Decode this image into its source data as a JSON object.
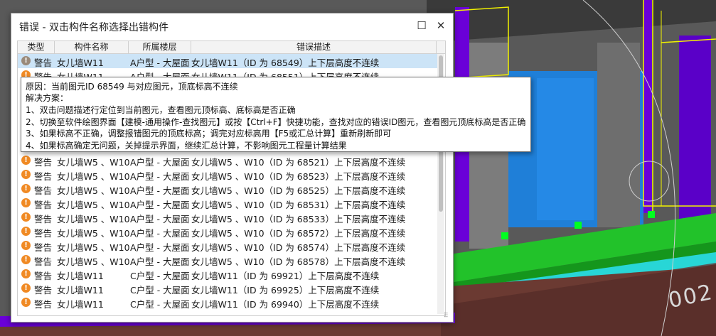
{
  "dialog": {
    "title": "错误 - 双击构件名称选择出错构件",
    "maximize_icon": "☐",
    "close_icon": "✕"
  },
  "grid": {
    "columns": [
      "类型",
      "构件名称",
      "所属楼层",
      "错误描述"
    ],
    "rows": [
      {
        "icon": "!",
        "icon_color": "#9a8a7a",
        "type": "警告",
        "name": "女儿墙W11",
        "floor": "A户型 - 大屋面",
        "desc": "女儿墙W11（ID 为 68549）上下层高度不连续",
        "selected": true
      },
      {
        "icon": "!",
        "icon_color": "#f08a24",
        "type": "警告",
        "name": "女儿墙W11",
        "floor": "A户型 - 大屋面",
        "desc": "女儿墙W11（ID 为 68551）上下层高度不连续"
      },
      {
        "icon": "!",
        "icon_color": "#f08a24",
        "type": "",
        "name": "",
        "floor": "",
        "desc": ""
      },
      {
        "icon": "!",
        "icon_color": "#f08a24",
        "type": "",
        "name": "",
        "floor": "",
        "desc": ""
      },
      {
        "icon": "!",
        "icon_color": "#f08a24",
        "type": "",
        "name": "",
        "floor": "",
        "desc": ""
      },
      {
        "icon": "!",
        "icon_color": "#f08a24",
        "type": "",
        "name": "",
        "floor": "",
        "desc": ""
      },
      {
        "icon": "!",
        "icon_color": "#f08a24",
        "type": "",
        "name": "",
        "floor": "",
        "desc": ""
      },
      {
        "icon": "!",
        "icon_color": "#f08a24",
        "type": "警告",
        "name": "女儿墙W5 、W10",
        "floor": "A户型 - 大屋面",
        "desc": "女儿墙W5 、W10（ID 为 68521）上下层高度不连续"
      },
      {
        "icon": "!",
        "icon_color": "#f08a24",
        "type": "警告",
        "name": "女儿墙W5 、W10",
        "floor": "A户型 - 大屋面",
        "desc": "女儿墙W5 、W10（ID 为 68523）上下层高度不连续"
      },
      {
        "icon": "!",
        "icon_color": "#f08a24",
        "type": "警告",
        "name": "女儿墙W5 、W10",
        "floor": "A户型 - 大屋面",
        "desc": "女儿墙W5 、W10（ID 为 68525）上下层高度不连续"
      },
      {
        "icon": "!",
        "icon_color": "#f08a24",
        "type": "警告",
        "name": "女儿墙W5 、W10",
        "floor": "A户型 - 大屋面",
        "desc": "女儿墙W5 、W10（ID 为 68531）上下层高度不连续"
      },
      {
        "icon": "!",
        "icon_color": "#f08a24",
        "type": "警告",
        "name": "女儿墙W5 、W10",
        "floor": "A户型 - 大屋面",
        "desc": "女儿墙W5 、W10（ID 为 68533）上下层高度不连续"
      },
      {
        "icon": "!",
        "icon_color": "#f08a24",
        "type": "警告",
        "name": "女儿墙W5 、W10",
        "floor": "A户型 - 大屋面",
        "desc": "女儿墙W5 、W10（ID 为 68572）上下层高度不连续"
      },
      {
        "icon": "!",
        "icon_color": "#f08a24",
        "type": "警告",
        "name": "女儿墙W5 、W10",
        "floor": "A户型 - 大屋面",
        "desc": "女儿墙W5 、W10（ID 为 68574）上下层高度不连续"
      },
      {
        "icon": "!",
        "icon_color": "#f08a24",
        "type": "警告",
        "name": "女儿墙W5 、W10",
        "floor": "A户型 - 大屋面",
        "desc": "女儿墙W5 、W10（ID 为 68578）上下层高度不连续"
      },
      {
        "icon": "!",
        "icon_color": "#f08a24",
        "type": "警告",
        "name": "女儿墙W11",
        "floor": "C户型 - 大屋面",
        "desc": "女儿墙W11（ID 为 69921）上下层高度不连续"
      },
      {
        "icon": "!",
        "icon_color": "#f08a24",
        "type": "警告",
        "name": "女儿墙W11",
        "floor": "C户型 - 大屋面",
        "desc": "女儿墙W11（ID 为 69925）上下层高度不连续"
      },
      {
        "icon": "!",
        "icon_color": "#f08a24",
        "type": "警告",
        "name": "女儿墙W11",
        "floor": "C户型 - 大屋面",
        "desc": "女儿墙W11（ID 为 69940）上下层高度不连续"
      }
    ]
  },
  "tooltip": {
    "lines": [
      "原因：当前图元ID 68549 与对应图元，顶底标高不连续",
      "解决方案：",
      "1、双击问题描述行定位到当前图元，查看图元顶标高、底标高是否正确",
      "2、切换至软件绘图界面【建模-通用操作-查找图元】或按【Ctrl+F】快捷功能，查找对应的错误ID图元，查看图元顶底标高是否正确",
      "3、如果标高不正确，调整报错图元的顶底标高；调完对应标高用【F5或汇总计算】重新刷新即可",
      "4、如果标高确定无问题，关掉提示界面，继续汇总计算，不影响图元工程量计算结果"
    ]
  },
  "viewport": {
    "label": "002"
  },
  "colors": {
    "accent_selected": "#cce4f7",
    "warning": "#f08a24"
  }
}
